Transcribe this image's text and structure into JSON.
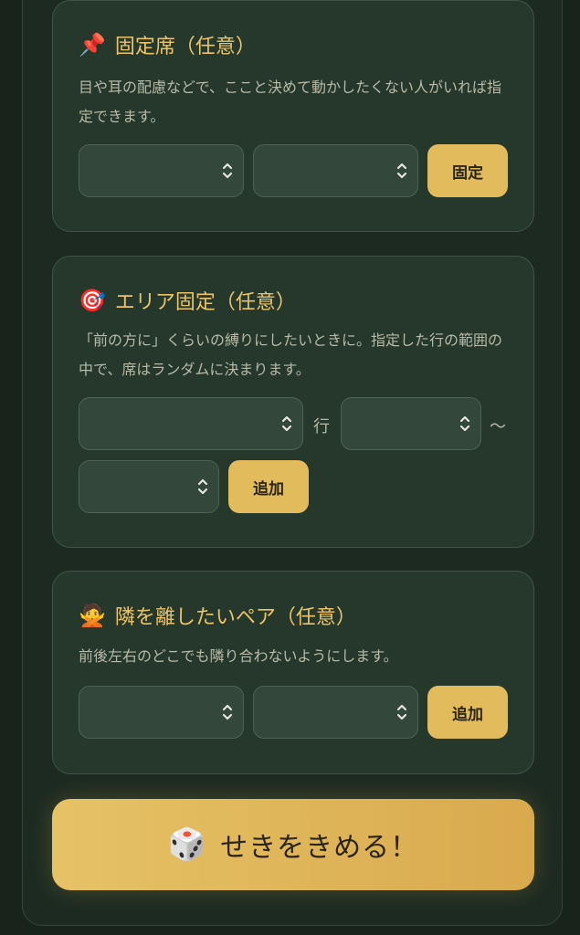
{
  "fixed_seat": {
    "emoji": "📌",
    "title": "固定席（任意）",
    "description": "目や耳の配慮などで、ここと決めて動かしたくない人がいれば指定できます。",
    "button_label": "固定"
  },
  "area_fixed": {
    "emoji": "🎯",
    "title": "エリア固定（任意）",
    "description": "「前の方に」くらいの縛りにしたいときに。指定した行の範囲の中で、席はランダムに決まります。",
    "row_unit": "行",
    "range_sep": "〜",
    "button_label": "追加"
  },
  "separate_pair": {
    "emoji": "🙅",
    "title": "隣を離したいペア（任意）",
    "description": "前後左右のどこでも隣り合わないようにします。",
    "button_label": "追加"
  },
  "main_action": {
    "emoji": "🎲",
    "label": "せきをきめる！"
  }
}
